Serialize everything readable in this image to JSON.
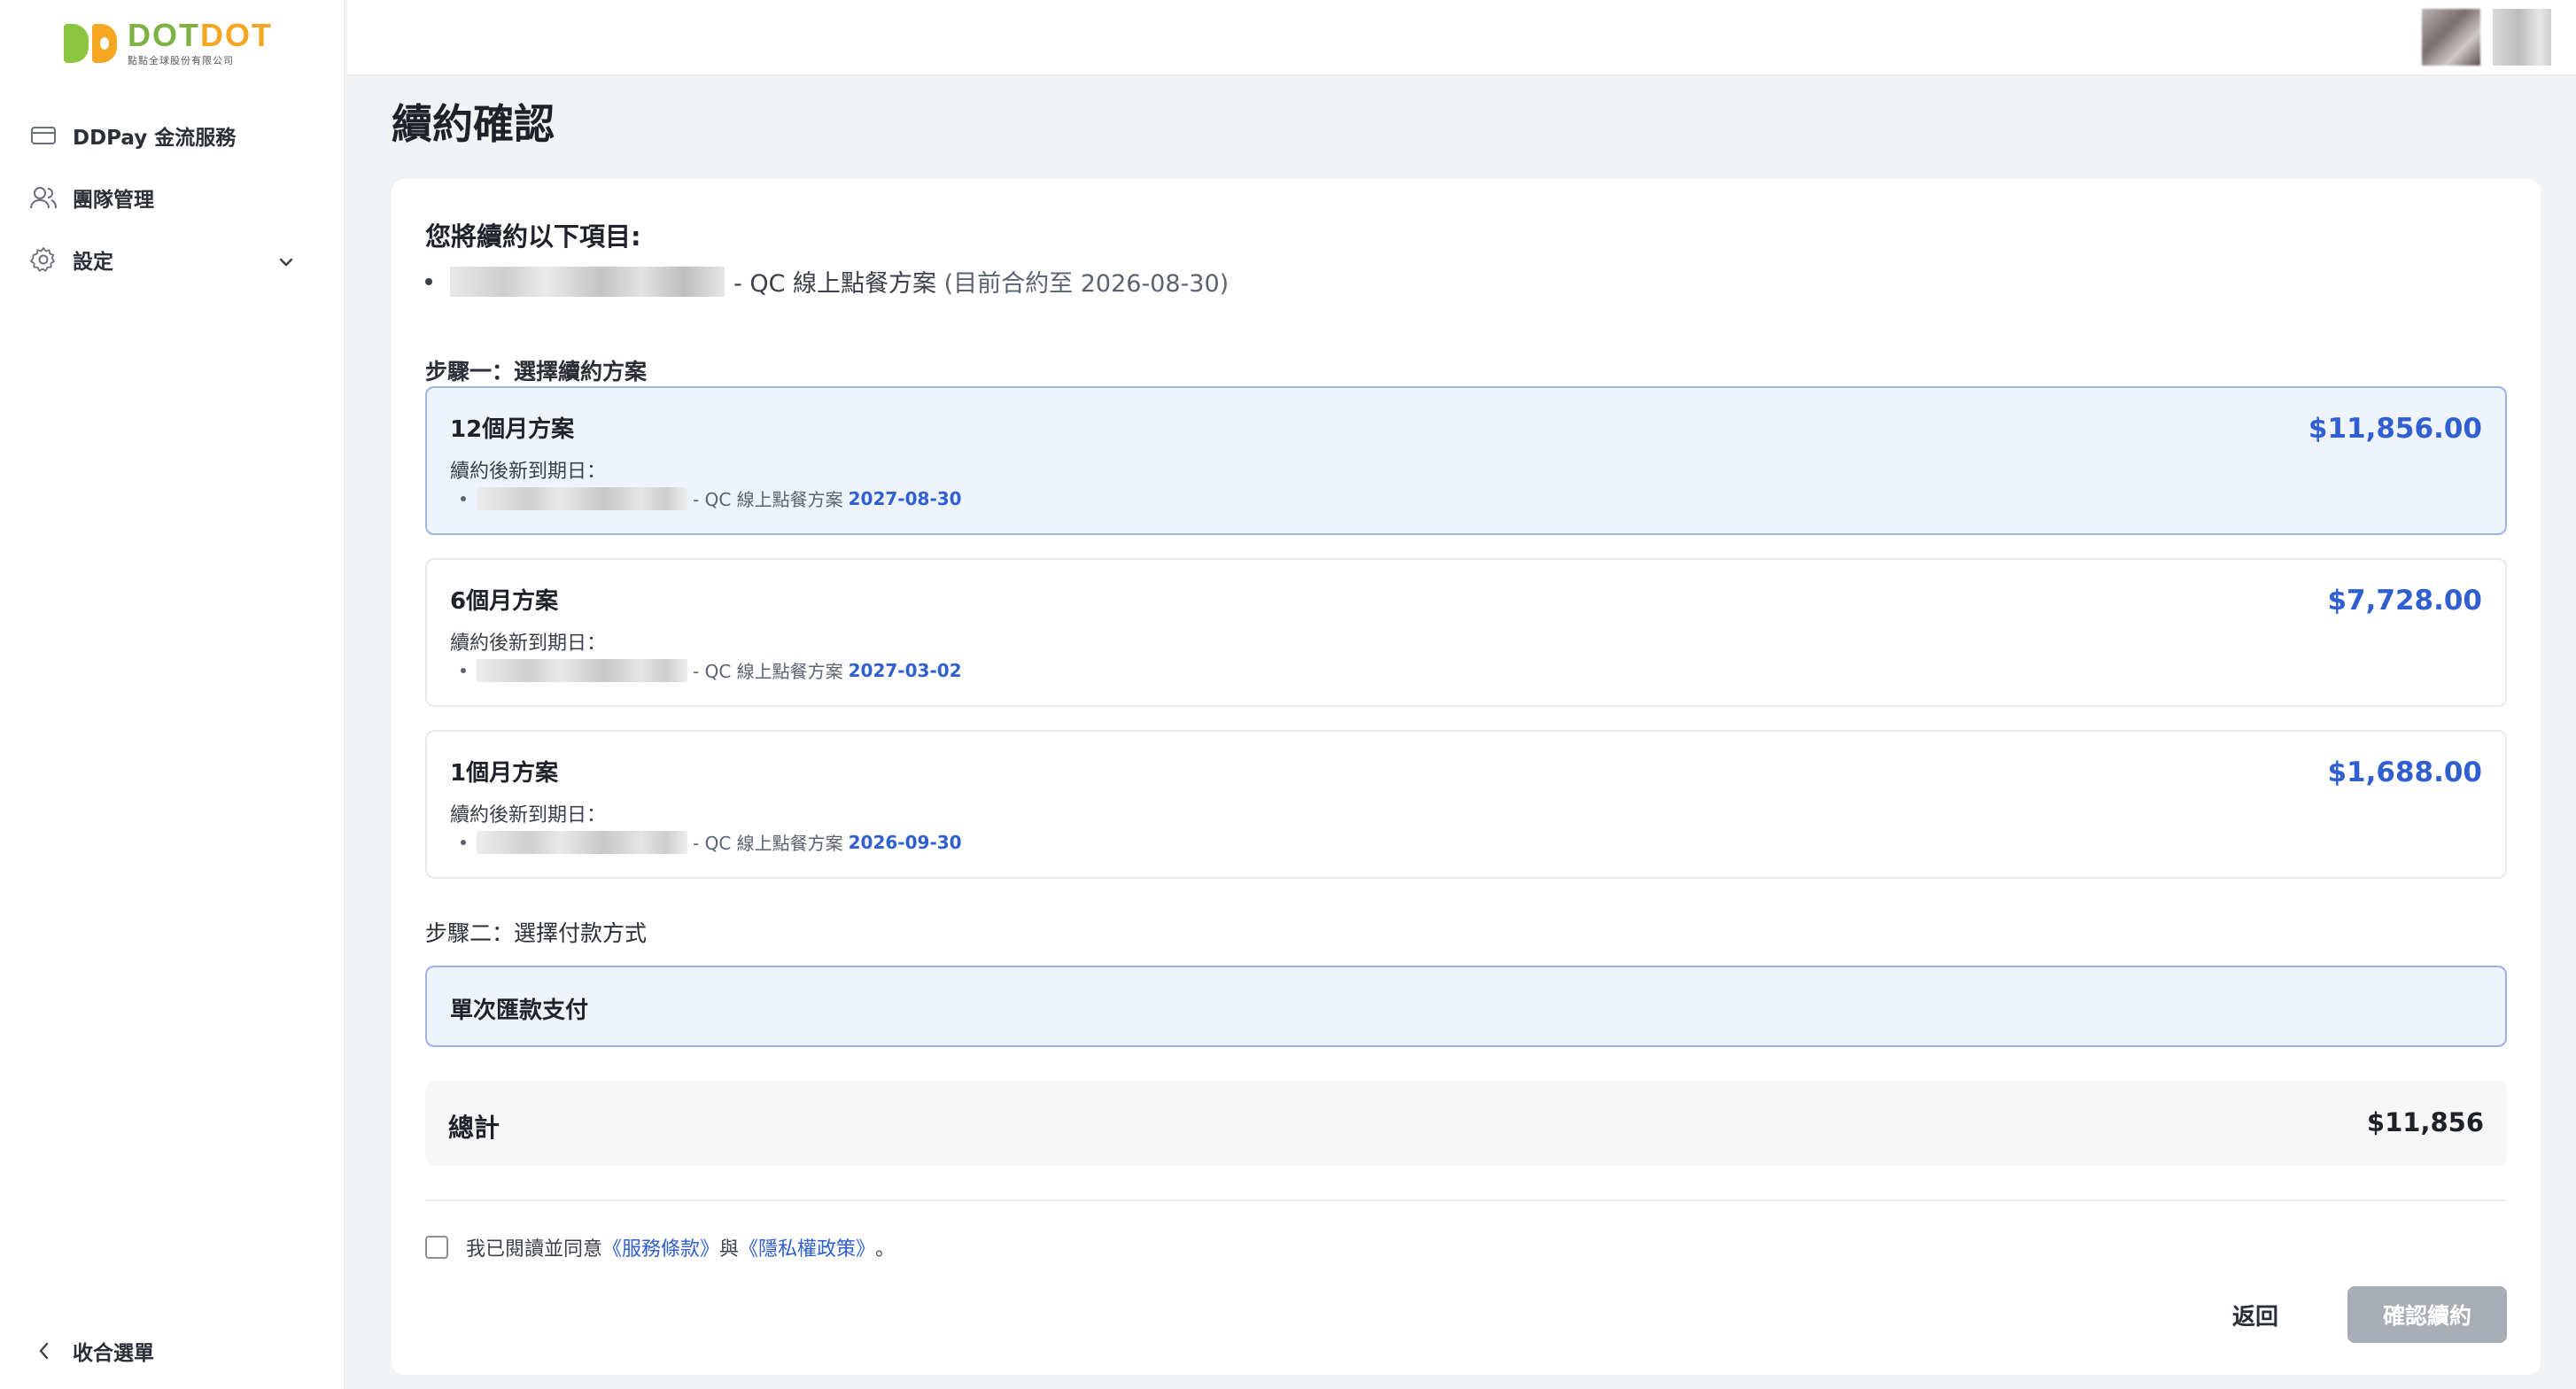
{
  "sidebar": {
    "logo": {
      "title_a": "DOT",
      "title_b": "DOT",
      "subtitle": "點點全球股份有限公司"
    },
    "items": [
      {
        "label": "DDPay 金流服務",
        "icon": "credit-card-icon"
      },
      {
        "label": "團隊管理",
        "icon": "users-icon"
      },
      {
        "label": "設定",
        "icon": "gear-icon"
      }
    ],
    "collapse_label": "收合選單"
  },
  "header": {
    "notification_icon": "bell-icon"
  },
  "page": {
    "title": "續約確認",
    "will_renew_heading": "您將續約以下項目:",
    "item_plan": "- QC 線上點餐方案",
    "item_current": "(目前合約至 2026-08-30)",
    "step1": "步驟一：選擇續約方案",
    "new_due_label": "續約後新到期日：",
    "plans": [
      {
        "name": "12個月方案",
        "price": "$11,856.00",
        "plan_text": "- QC 線上點餐方案",
        "date": "2027-08-30",
        "selected": true
      },
      {
        "name": "6個月方案",
        "price": "$7,728.00",
        "plan_text": "- QC 線上點餐方案",
        "date": "2027-03-02",
        "selected": false
      },
      {
        "name": "1個月方案",
        "price": "$1,688.00",
        "plan_text": "- QC 線上點餐方案",
        "date": "2026-09-30",
        "selected": false
      }
    ],
    "step2": "步驟二：選擇付款方式",
    "payment_method": "單次匯款支付",
    "total_label": "總計",
    "total_value": "$11,856",
    "agree_prefix": "我已閱讀並同意",
    "terms_link": "《服務條款》",
    "agree_and": "與",
    "privacy_link": "《隱私權政策》",
    "agree_suffix": "。",
    "back_button": "返回",
    "confirm_button": "確認續約"
  },
  "colors": {
    "accent": "#2f5fd0",
    "selected_bg": "#eef3fc",
    "disabled_button": "#a9aeb6"
  }
}
